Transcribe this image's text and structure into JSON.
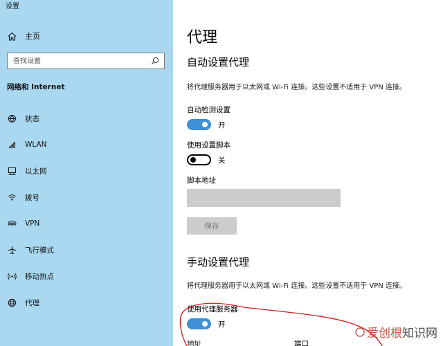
{
  "window_title": "设置",
  "sidebar": {
    "home_label": "主页",
    "search_placeholder": "查找设置",
    "section_title": "网络和 Internet",
    "items": [
      {
        "label": "状态",
        "icon": "status-icon"
      },
      {
        "label": "WLAN",
        "icon": "wifi-icon"
      },
      {
        "label": "以太网",
        "icon": "ethernet-icon"
      },
      {
        "label": "拨号",
        "icon": "dialup-icon"
      },
      {
        "label": "VPN",
        "icon": "vpn-icon"
      },
      {
        "label": "飞行模式",
        "icon": "airplane-icon"
      },
      {
        "label": "移动热点",
        "icon": "hotspot-icon"
      },
      {
        "label": "代理",
        "icon": "globe-icon"
      }
    ]
  },
  "main": {
    "title": "代理",
    "auto": {
      "heading": "自动设置代理",
      "description": "将代理服务器用于以太网或 Wi-Fi 连接。这些设置不适用于 VPN 连接。",
      "detect_label": "自动检测设置",
      "detect_state": "开",
      "script_label": "使用设置脚本",
      "script_state": "关",
      "address_label": "脚本地址",
      "save_label": "保存"
    },
    "manual": {
      "heading": "手动设置代理",
      "description": "将代理服务器用于以太网或 Wi-Fi 连接。这些设置不适用于 VPN 连接。",
      "proxy_label": "使用代理服务器",
      "proxy_state": "开",
      "address_label": "地址",
      "port_label": "端口"
    }
  },
  "watermark": {
    "text_red": "爱创根",
    "text_dark": "知识网"
  },
  "colors": {
    "sidebar_bg": "#a9d8f0",
    "toggle_on": "#3f8fd6",
    "annotation": "#d11a1a"
  }
}
